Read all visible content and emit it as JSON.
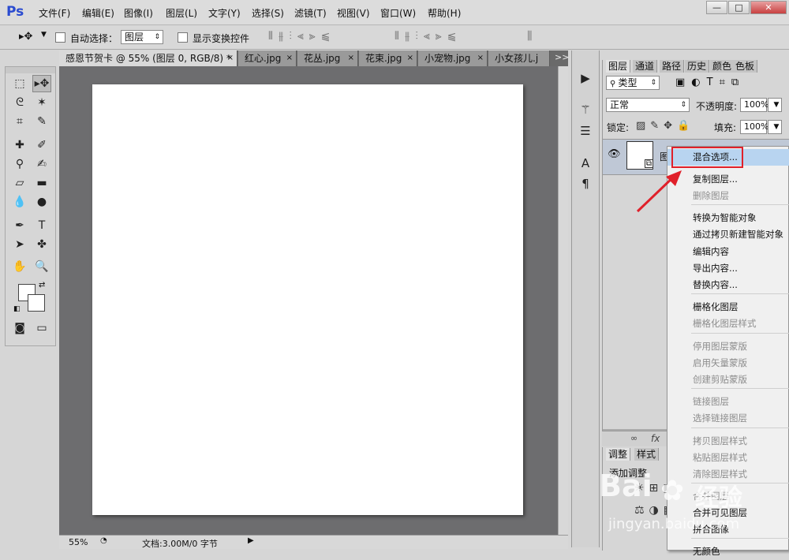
{
  "app": {
    "logo": "Ps"
  },
  "menubar": {
    "items": [
      "文件(F)",
      "编辑(E)",
      "图像(I)",
      "图层(L)",
      "文字(Y)",
      "选择(S)",
      "滤镜(T)",
      "视图(V)",
      "窗口(W)",
      "帮助(H)"
    ],
    "window_buttons": [
      "—",
      "□",
      "✕"
    ]
  },
  "options": {
    "auto_select_label": "自动选择：",
    "auto_select_value": "图层",
    "show_transform_label": "显示变换控件"
  },
  "tabs": [
    {
      "label": "感恩节贺卡 @ 55% (图层 0, RGB/8) *",
      "close": "×"
    },
    {
      "label": "红心.jpg",
      "close": "×"
    },
    {
      "label": "花丛.jpg",
      "close": "×"
    },
    {
      "label": "花束.jpg",
      "close": "×"
    },
    {
      "label": "小宠物.jpg",
      "close": "×"
    },
    {
      "label": "小女孩儿.j",
      "close": ""
    }
  ],
  "tab_overflow": ">>",
  "status": {
    "zoom": "55%",
    "doc": "文档:3.00M/0 字节"
  },
  "layers_panel": {
    "tabs": [
      "图层",
      "通道",
      "路径",
      "历史",
      "颜色",
      "色板"
    ],
    "filter_label": "类型",
    "blend_mode": "正常",
    "opacity_label": "不透明度:",
    "opacity_value": "100%",
    "lock_label": "锁定:",
    "fill_label": "填充:",
    "fill_value": "100%",
    "layer_name_partial": "图",
    "bottom_icons": [
      "∞",
      "fx"
    ]
  },
  "adj_panel": {
    "tabs": [
      "调整",
      "样式"
    ],
    "add_label": "添加调整"
  },
  "context_menu": {
    "items": [
      {
        "label": "混合选项...",
        "state": "highlight"
      },
      {
        "label": "复制图层...",
        "state": "enabled"
      },
      {
        "label": "删除图层",
        "state": "disabled"
      },
      {
        "label": "转换为智能对象",
        "state": "enabled"
      },
      {
        "label": "通过拷贝新建智能对象",
        "state": "enabled"
      },
      {
        "label": "编辑内容",
        "state": "enabled"
      },
      {
        "label": "导出内容...",
        "state": "enabled"
      },
      {
        "label": "替换内容...",
        "state": "enabled"
      },
      {
        "label": "栅格化图层",
        "state": "enabled"
      },
      {
        "label": "栅格化图层样式",
        "state": "disabled"
      },
      {
        "label": "停用图层蒙版",
        "state": "disabled"
      },
      {
        "label": "启用矢量蒙版",
        "state": "disabled"
      },
      {
        "label": "创建剪贴蒙版",
        "state": "disabled"
      },
      {
        "label": "链接图层",
        "state": "disabled"
      },
      {
        "label": "选择链接图层",
        "state": "disabled"
      },
      {
        "label": "拷贝图层样式",
        "state": "disabled"
      },
      {
        "label": "粘贴图层样式",
        "state": "disabled"
      },
      {
        "label": "清除图层样式",
        "state": "disabled"
      },
      {
        "label": "合并图层",
        "state": "disabled"
      },
      {
        "label": "合并可见图层",
        "state": "enabled"
      },
      {
        "label": "拼合图像",
        "state": "enabled"
      },
      {
        "label": "无颜色",
        "state": "enabled"
      }
    ]
  },
  "watermark": {
    "brand": "Bai",
    "brand2": "经验",
    "url": "jingyan.baidu.com"
  },
  "colors": {
    "highlight": "#b8d4f0",
    "annotation_red": "#e0202a",
    "canvas_bg": "#6d6d6f"
  }
}
